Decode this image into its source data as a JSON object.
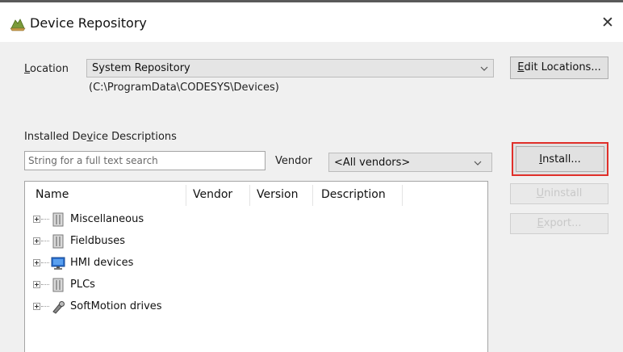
{
  "window": {
    "title": "Device Repository",
    "close_glyph": "✕"
  },
  "location": {
    "label_prefix": "",
    "label_accel": "L",
    "label_rest": "ocation",
    "selected": "System Repository",
    "path": "(C:\\ProgramData\\CODESYS\\Devices)"
  },
  "buttons": {
    "edit_locations_accel": "E",
    "edit_locations_rest": "dit Locations...",
    "install_accel": "I",
    "install_rest": "nstall...",
    "uninstall_accel": "U",
    "uninstall_rest": "ninstall",
    "export_accel": "E",
    "export_rest": "xport..."
  },
  "installed": {
    "heading_start": "Installed De",
    "heading_accel": "v",
    "heading_end": "ice Descriptions",
    "search_placeholder": "String for a full text search",
    "vendor_label": "Vendor",
    "vendor_selected": "<All vendors>"
  },
  "tree": {
    "columns": [
      "Name",
      "Vendor",
      "Version",
      "Description"
    ],
    "items": [
      {
        "label": "Miscellaneous",
        "icon": "device-module-icon"
      },
      {
        "label": "Fieldbuses",
        "icon": "device-module-icon"
      },
      {
        "label": "HMI devices",
        "icon": "monitor-icon"
      },
      {
        "label": "PLCs",
        "icon": "device-module-icon"
      },
      {
        "label": "SoftMotion drives",
        "icon": "drive-icon"
      }
    ]
  },
  "colors": {
    "install_highlight": "#e0302a",
    "dialog_bg": "#f0f0f0",
    "hmi_icon_blue": "#2a6fcf"
  }
}
